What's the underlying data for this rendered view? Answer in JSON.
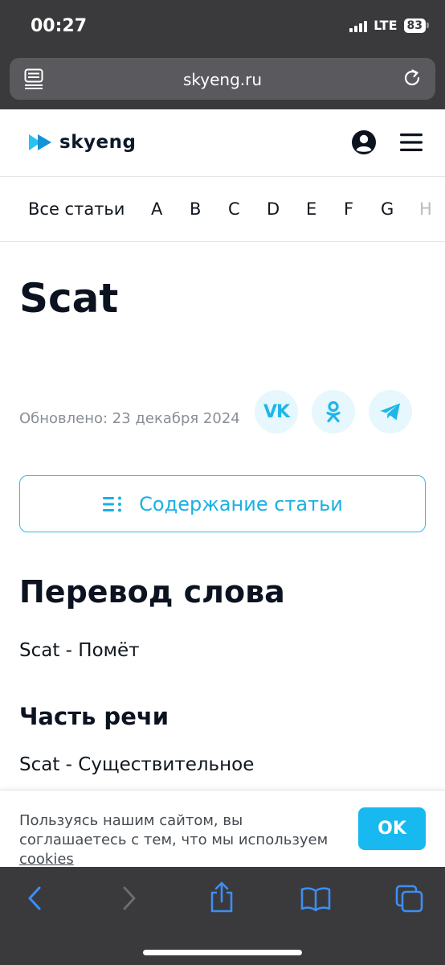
{
  "status_bar": {
    "time": "00:27",
    "network": "LTE",
    "battery": "83"
  },
  "browser": {
    "url": "skyeng.ru",
    "left_icon": "page-menu-icon",
    "right_icon": "reload-icon"
  },
  "header": {
    "logo_text": "skyeng",
    "user_icon": "user-icon",
    "menu_icon": "hamburger-menu-icon"
  },
  "alphabet_nav": {
    "all_label": "Все статьи",
    "letters": [
      "A",
      "B",
      "C",
      "D",
      "E",
      "F",
      "G",
      "H"
    ]
  },
  "article": {
    "title": "Scat",
    "updated": "Обновлено: 23 декабря 2024",
    "share": [
      {
        "name": "vk",
        "label": "VK"
      },
      {
        "name": "ok",
        "label": "odnoklassniki"
      },
      {
        "name": "telegram",
        "label": "telegram"
      }
    ],
    "toc_label": "Содержание статьи",
    "translation_heading": "Перевод слова",
    "translation_text": "Scat - Помёт",
    "pos_heading": "Часть речи",
    "pos_text": "Scat - Существительное"
  },
  "cookie": {
    "text": "Пользуясь нашим сайтом, вы соглашаетесь с тем, что мы используем ",
    "link": "cookies",
    "button": "OK"
  },
  "toolbar": {
    "icons": [
      "back-icon",
      "forward-icon",
      "share-icon",
      "bookmarks-icon",
      "tabs-icon"
    ]
  },
  "colors": {
    "accent": "#17b9f0",
    "browser_chrome": "#3a3a3c",
    "toolbar_active": "#3d8ef5"
  }
}
